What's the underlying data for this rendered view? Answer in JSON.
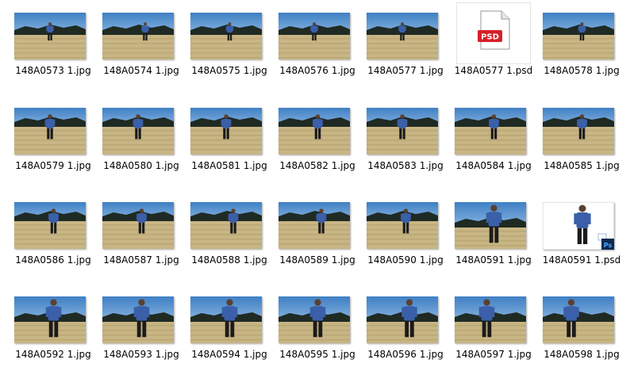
{
  "files": [
    {
      "name": "148A0573 1.jpg",
      "kind": "photo",
      "variant": "far",
      "figure_offset": 0.5
    },
    {
      "name": "148A0574 1.jpg",
      "kind": "photo",
      "variant": "far",
      "figure_offset": 0.6
    },
    {
      "name": "148A0575 1.jpg",
      "kind": "photo",
      "variant": "far",
      "figure_offset": 0.55
    },
    {
      "name": "148A0576 1.jpg",
      "kind": "photo",
      "variant": "far",
      "figure_offset": 0.5
    },
    {
      "name": "148A0577 1.jpg",
      "kind": "photo",
      "variant": "far",
      "figure_offset": 0.5
    },
    {
      "name": "148A0577 1.psd",
      "kind": "psd-icon",
      "icon_text": "PSD",
      "icon_color": "#d6202a"
    },
    {
      "name": "148A0578 1.jpg",
      "kind": "photo",
      "variant": "far",
      "figure_offset": 0.55
    },
    {
      "name": "148A0579 1.jpg",
      "kind": "photo",
      "variant": "mid",
      "figure_offset": 0.5
    },
    {
      "name": "148A0580 1.jpg",
      "kind": "photo",
      "variant": "mid",
      "figure_offset": 0.5
    },
    {
      "name": "148A0581 1.jpg",
      "kind": "photo",
      "variant": "mid",
      "figure_offset": 0.5
    },
    {
      "name": "148A0582 1.jpg",
      "kind": "photo",
      "variant": "mid",
      "figure_offset": 0.55
    },
    {
      "name": "148A0583 1.jpg",
      "kind": "photo",
      "variant": "mid",
      "figure_offset": 0.5
    },
    {
      "name": "148A0584 1.jpg",
      "kind": "photo",
      "variant": "mid",
      "figure_offset": 0.55
    },
    {
      "name": "148A0585 1.jpg",
      "kind": "photo",
      "variant": "mid",
      "figure_offset": 0.55
    },
    {
      "name": "148A0586 1.jpg",
      "kind": "photo",
      "variant": "mid",
      "figure_offset": 0.55
    },
    {
      "name": "148A0587 1.jpg",
      "kind": "photo",
      "variant": "mid",
      "figure_offset": 0.55
    },
    {
      "name": "148A0588 1.jpg",
      "kind": "photo",
      "variant": "mid",
      "figure_offset": 0.6
    },
    {
      "name": "148A0589 1.jpg",
      "kind": "photo",
      "variant": "mid",
      "figure_offset": 0.6
    },
    {
      "name": "148A0590 1.jpg",
      "kind": "photo",
      "variant": "mid",
      "figure_offset": 0.55
    },
    {
      "name": "148A0591 1.jpg",
      "kind": "photo",
      "variant": "close",
      "figure_offset": 0.55
    },
    {
      "name": "148A0591 1.psd",
      "kind": "psd-preview",
      "badge_text": "Ps",
      "badge_color": "#0b2a52"
    },
    {
      "name": "148A0592 1.jpg",
      "kind": "photo",
      "variant": "close",
      "figure_offset": 0.55
    },
    {
      "name": "148A0593 1.jpg",
      "kind": "photo",
      "variant": "close",
      "figure_offset": 0.55
    },
    {
      "name": "148A0594 1.jpg",
      "kind": "photo",
      "variant": "close",
      "figure_offset": 0.55
    },
    {
      "name": "148A0595 1.jpg",
      "kind": "photo",
      "variant": "close",
      "figure_offset": 0.55
    },
    {
      "name": "148A0596 1.jpg",
      "kind": "photo",
      "variant": "close",
      "figure_offset": 0.6
    },
    {
      "name": "148A0597 1.jpg",
      "kind": "photo",
      "variant": "close",
      "figure_offset": 0.45
    },
    {
      "name": "148A0598 1.jpg",
      "kind": "photo",
      "variant": "close",
      "figure_offset": 0.4
    }
  ],
  "colors": {
    "sky": "#3f7fc4",
    "sky_light": "#8ab6e0",
    "hills": "#1f2a23",
    "field": "#c8b584",
    "field_dark": "#a89464",
    "shirt": "#3b5fa8",
    "pants": "#1b1b1b"
  }
}
